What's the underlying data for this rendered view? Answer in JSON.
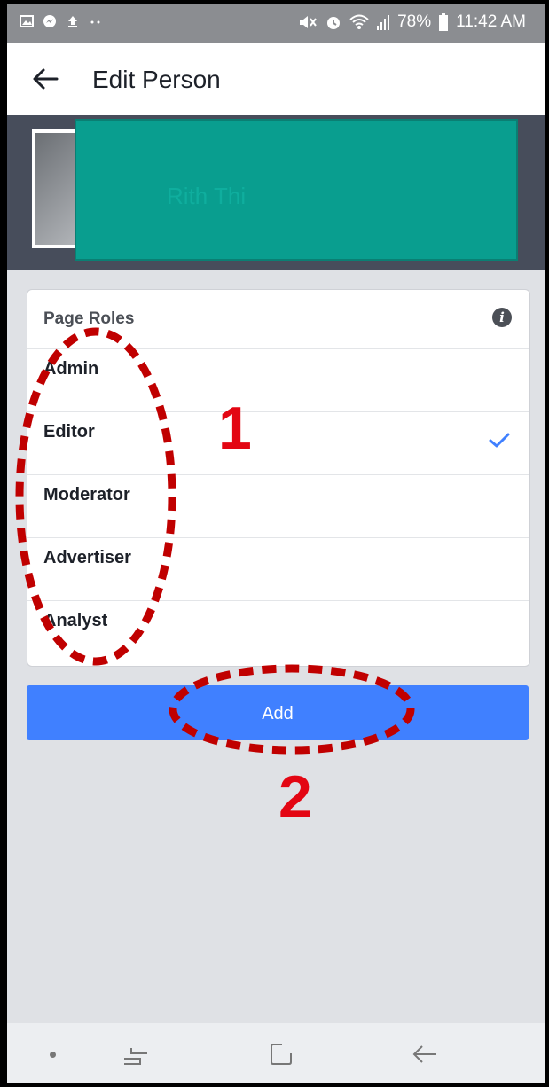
{
  "status_bar": {
    "left_icons": [
      "image-icon",
      "messenger-icon",
      "upload-icon",
      "more-dots-icon"
    ],
    "battery": "78%",
    "time": "11:42 AM",
    "right_icons": [
      "mute-icon",
      "alarm-icon",
      "wifi-icon",
      "signal-icon",
      "battery-icon"
    ]
  },
  "header": {
    "title": "Edit Person",
    "back_icon": "arrow-left-icon"
  },
  "profile": {
    "name": "Rith Thi"
  },
  "page_roles": {
    "title": "Page Roles",
    "info_icon": "info-icon",
    "info_glyph": "i",
    "roles": [
      {
        "label": "Admin",
        "selected": false
      },
      {
        "label": "Editor",
        "selected": true
      },
      {
        "label": "Moderator",
        "selected": false
      },
      {
        "label": "Advertiser",
        "selected": false
      },
      {
        "label": "Analyst",
        "selected": false
      }
    ]
  },
  "actions": {
    "add_label": "Add"
  },
  "annotations": {
    "label_1": "1",
    "label_2": "2",
    "color": "#e30613"
  },
  "nav_bar": {
    "icons": [
      "dot-icon",
      "recent-apps-icon",
      "home-icon",
      "back-icon"
    ]
  },
  "colors": {
    "accent": "#4080ff",
    "teal_overlay": "#099e8f",
    "status_bar": "#8b8d91"
  }
}
